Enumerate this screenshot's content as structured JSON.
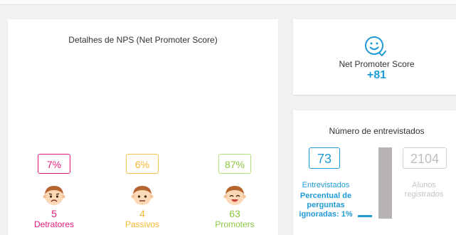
{
  "nps_details": {
    "title": "Detalhes de NPS (Net Promoter Score)",
    "categories": [
      {
        "percent": "7%",
        "count": "5",
        "label": "Detratores",
        "color": "#e6197a",
        "icon": "sad-face-icon"
      },
      {
        "percent": "6%",
        "count": "4",
        "label": "Passivos",
        "color": "#f7b52c",
        "icon": "neutral-face-icon"
      },
      {
        "percent": "87%",
        "count": "63",
        "label": "Promoters",
        "color": "#8cc63f",
        "icon": "happy-face-icon"
      }
    ]
  },
  "nps_score": {
    "icon": "smile-check-icon",
    "label": "Net Promoter Score",
    "value": "+81",
    "accent": "#1f9ad6"
  },
  "respondents": {
    "title": "Número de entrevistados",
    "interviewed": {
      "value": "73",
      "label": "Entrevistados"
    },
    "ignored_text": "Percentual de perguntas ignoradas: 1%",
    "students": {
      "value": "2104",
      "label": "Alunos registrados"
    }
  }
}
